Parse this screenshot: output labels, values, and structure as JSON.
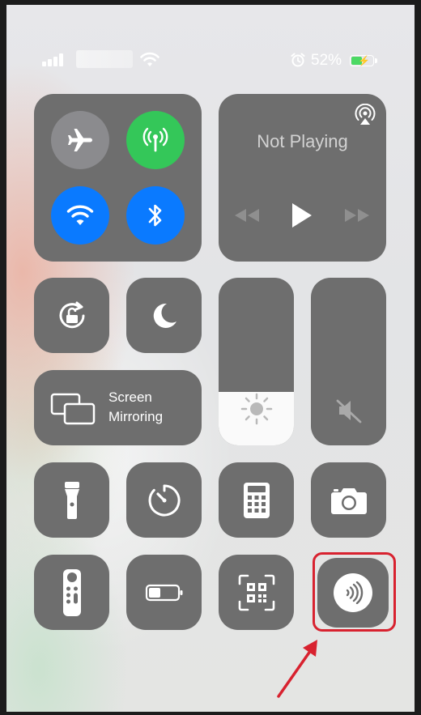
{
  "status_bar": {
    "battery_percent": "52%",
    "battery_level": 0.52,
    "icons": [
      "cellular-signal-icon",
      "wifi-icon",
      "alarm-icon",
      "battery-charging-icon"
    ]
  },
  "connectivity": {
    "airplane": {
      "icon": "airplane-icon",
      "active": false
    },
    "cellular": {
      "icon": "cellular-antenna-icon",
      "active": true,
      "color": "#34c759"
    },
    "wifi": {
      "icon": "wifi-icon",
      "active": true,
      "color": "#0a7aff"
    },
    "bluetooth": {
      "icon": "bluetooth-icon",
      "active": true,
      "color": "#0a7aff"
    }
  },
  "now_playing": {
    "title": "Not Playing",
    "icons": [
      "airplay-icon",
      "rewind-icon",
      "play-icon",
      "fast-forward-icon"
    ]
  },
  "toggles": {
    "rotation_lock_icon": "rotation-lock-icon",
    "do_not_disturb_icon": "moon-icon"
  },
  "screen_mirroring": {
    "label_line1": "Screen",
    "label_line2": "Mirroring",
    "icon": "screen-mirroring-icon"
  },
  "brightness": {
    "icon": "sun-icon",
    "level": 0.32
  },
  "volume": {
    "icon": "speaker-muted-icon",
    "level": 0.0
  },
  "shortcuts_row1": [
    "flashlight-icon",
    "timer-icon",
    "calculator-icon",
    "camera-icon"
  ],
  "shortcuts_row2": [
    "apple-tv-remote-icon",
    "low-power-mode-icon",
    "qr-code-scanner-icon",
    "nfc-tag-reader-icon"
  ],
  "annotation": {
    "highlight_color": "#d8222f",
    "target": "nfc-tag-reader-button"
  }
}
